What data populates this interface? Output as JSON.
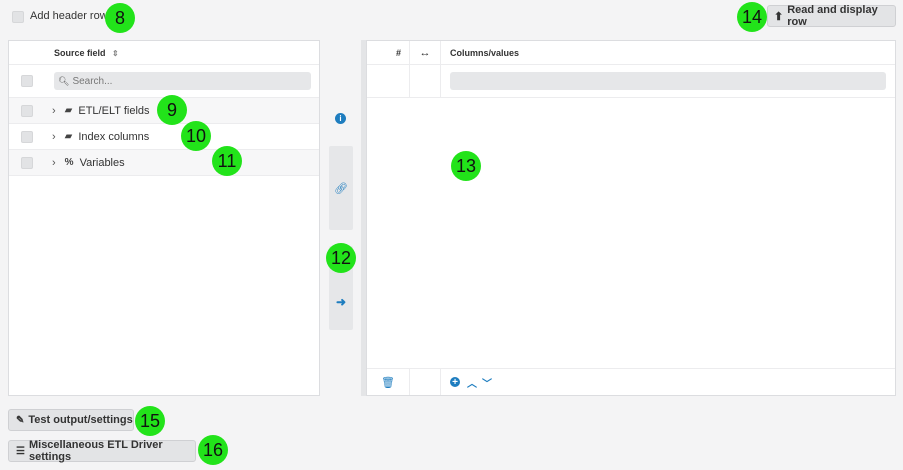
{
  "header": {
    "add_header_row_label": "Add header row",
    "read_button_label": "Read and display row"
  },
  "left_panel": {
    "column_header": "Source field",
    "search_placeholder": "Search...",
    "tree": [
      {
        "label": "ETL/ELT fields",
        "icon": "folder-icon"
      },
      {
        "label": "Index columns",
        "icon": "folder-icon"
      },
      {
        "label": "Variables",
        "icon": "variable-icon"
      }
    ]
  },
  "right_panel": {
    "col_hash": "#",
    "col_arrow": "↔",
    "col_values": "Columns/values"
  },
  "footer": {
    "test_button_label": "Test output/settings",
    "misc_button_label": "Miscellaneous ETL Driver settings"
  },
  "markers": {
    "m8": "8",
    "m9": "9",
    "m10": "10",
    "m11": "11",
    "m12": "12",
    "m13": "13",
    "m14": "14",
    "m15": "15",
    "m16": "16"
  },
  "colors": {
    "marker": "#22e31a",
    "accent": "#1e7dbf"
  }
}
